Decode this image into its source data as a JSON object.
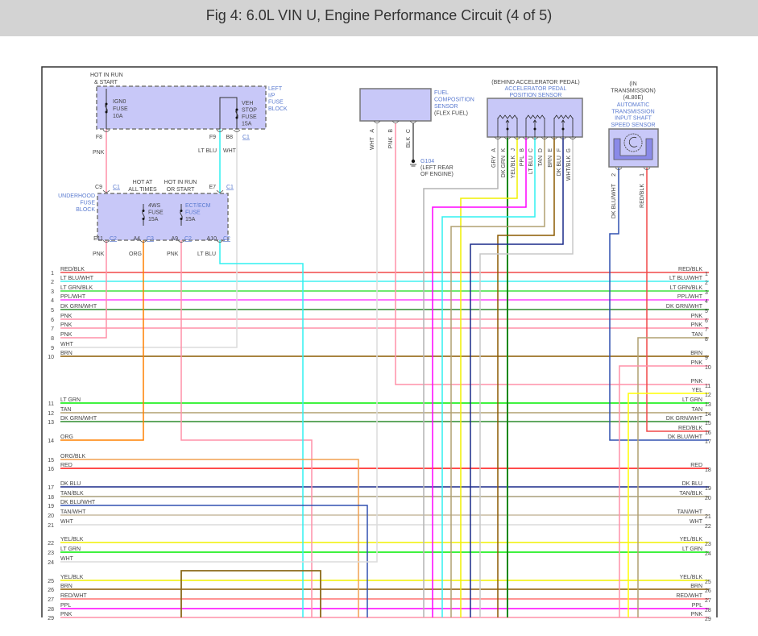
{
  "title": "Fig 4: 6.0L VIN U, Engine Performance Circuit (4 of 5)",
  "left_ip_fuse_block": {
    "name": [
      "LEFT",
      "I/P",
      "FUSE",
      "BLOCK"
    ],
    "supply": [
      "HOT IN RUN",
      "& START"
    ],
    "fuse_ign0": [
      "IGN0",
      "FUSE",
      "10A"
    ],
    "fuse_veh_stop": [
      "VEH",
      "STOP",
      "FUSE",
      "15A"
    ],
    "pins": [
      {
        "pin": "F8",
        "wire": "PNK"
      },
      {
        "pin": "F9",
        "wire": "LT BLU"
      },
      {
        "pin": "B8",
        "wire": "WHT"
      }
    ],
    "connector": "C1"
  },
  "underhood_fuse_block": {
    "name": [
      "UNDERHOOD",
      "FUSE",
      "BLOCK"
    ],
    "supply_4ws": [
      "HOT AT",
      "ALL TIMES"
    ],
    "supply_ect": [
      "HOT IN RUN",
      "OR START"
    ],
    "fuse_4ws": [
      "4WS",
      "FUSE",
      "15A"
    ],
    "fuse_ect": [
      "ECT/ECM",
      "FUSE",
      "15A"
    ],
    "top_pins": [
      {
        "pin": "C9",
        "conn": "C1"
      },
      {
        "pin": "E7",
        "conn": "C1"
      }
    ],
    "bottom_pins": [
      {
        "pin": "E11",
        "conn": "C2",
        "wire": "PNK"
      },
      {
        "pin": "A4",
        "conn": "C3",
        "wire": "ORG"
      },
      {
        "pin": "A9",
        "conn": "C2",
        "wire": "PNK"
      },
      {
        "pin": "A10",
        "conn": "C2",
        "wire": "LT BLU"
      }
    ]
  },
  "fuel_sensor": {
    "name": [
      "FUEL",
      "COMPOSITION",
      "SENSOR",
      "(FLEX FUEL)"
    ],
    "pins": [
      {
        "pin": "A",
        "wire": "WHT"
      },
      {
        "pin": "B",
        "wire": "PNK"
      },
      {
        "pin": "C",
        "wire": "BLK"
      }
    ],
    "ground": {
      "id": "G104",
      "location": [
        "(LEFT REAR",
        "OF ENGINE)"
      ]
    }
  },
  "app_sensor": {
    "location": "(BEHIND ACCELERATOR PEDAL)",
    "name": [
      "ACCELERATOR PEDAL",
      "POSITION SENSOR"
    ],
    "pins": [
      {
        "pin": "A",
        "wire": "GRY"
      },
      {
        "pin": "K",
        "wire": "DK GRN"
      },
      {
        "pin": "J",
        "wire": "YEL/BLK"
      },
      {
        "pin": "B",
        "wire": "PPL"
      },
      {
        "pin": "C",
        "wire": "LT BLU"
      },
      {
        "pin": "D",
        "wire": "TAN"
      },
      {
        "pin": "E",
        "wire": "BRN"
      },
      {
        "pin": "F",
        "wire": "DK BLU"
      },
      {
        "pin": "G",
        "wire": "WHT/BLK"
      }
    ]
  },
  "trans_sensor": {
    "location": [
      "(IN",
      "TRANSMISSION)",
      "(4L80E)"
    ],
    "name": [
      "AUTOMATIC",
      "TRANSMISSION",
      "INPUT SHAFT",
      "SPEED SENSOR"
    ],
    "pins": [
      {
        "pin": "2",
        "wire": "DK BLU/WHT"
      },
      {
        "pin": "1",
        "wire": "RED/BLK"
      }
    ]
  },
  "left_rows": [
    {
      "n": "1",
      "label": "RED/BLK"
    },
    {
      "n": "2",
      "label": "LT BLU/WHT"
    },
    {
      "n": "3",
      "label": "LT GRN/BLK"
    },
    {
      "n": "4",
      "label": "PPL/WHT"
    },
    {
      "n": "5",
      "label": "DK GRN/WHT"
    },
    {
      "n": "6",
      "label": "PNK"
    },
    {
      "n": "7",
      "label": "PNK"
    },
    {
      "n": "8",
      "label": "PNK"
    },
    {
      "n": "9",
      "label": "WHT"
    },
    {
      "n": "10",
      "label": "BRN"
    },
    {
      "n": "11",
      "label": "LT GRN"
    },
    {
      "n": "12",
      "label": "TAN"
    },
    {
      "n": "13",
      "label": "DK GRN/WHT"
    },
    {
      "n": "14",
      "label": "ORG"
    },
    {
      "n": "15",
      "label": "ORG/BLK"
    },
    {
      "n": "16",
      "label": "RED"
    },
    {
      "n": "17",
      "label": "DK BLU"
    },
    {
      "n": "18",
      "label": "TAN/BLK"
    },
    {
      "n": "19",
      "label": "DK BLU/WHT"
    },
    {
      "n": "20",
      "label": "TAN/WHT"
    },
    {
      "n": "21",
      "label": "WHT"
    },
    {
      "n": "22",
      "label": "YEL/BLK"
    },
    {
      "n": "23",
      "label": "LT GRN"
    },
    {
      "n": "24",
      "label": "WHT"
    },
    {
      "n": "25",
      "label": "YEL/BLK"
    },
    {
      "n": "26",
      "label": "BRN"
    },
    {
      "n": "27",
      "label": "RED/WHT"
    },
    {
      "n": "28",
      "label": "PPL"
    },
    {
      "n": "29",
      "label": "PNK"
    }
  ],
  "right_rows": [
    {
      "n": "1",
      "label": "RED/BLK"
    },
    {
      "n": "2",
      "label": "LT BLU/WHT"
    },
    {
      "n": "3",
      "label": "LT GRN/BLK"
    },
    {
      "n": "4",
      "label": "PPL/WHT"
    },
    {
      "n": "5",
      "label": "DK GRN/WHT"
    },
    {
      "n": "6",
      "label": "PNK"
    },
    {
      "n": "7",
      "label": "PNK"
    },
    {
      "n": "8",
      "label": "TAN"
    },
    {
      "n": "9",
      "label": "BRN"
    },
    {
      "n": "10",
      "label": "PNK"
    },
    {
      "n": "11",
      "label": "PNK"
    },
    {
      "n": "12",
      "label": "YEL"
    },
    {
      "n": "13",
      "label": "LT GRN"
    },
    {
      "n": "14",
      "label": "TAN"
    },
    {
      "n": "15",
      "label": "DK GRN/WHT"
    },
    {
      "n": "16",
      "label": "RED/BLK"
    },
    {
      "n": "17",
      "label": "DK BLU/WHT"
    },
    {
      "n": "18",
      "label": "RED"
    },
    {
      "n": "19",
      "label": "DK BLU"
    },
    {
      "n": "20",
      "label": "TAN/BLK"
    },
    {
      "n": "21",
      "label": "TAN/WHT"
    },
    {
      "n": "22",
      "label": "WHT"
    },
    {
      "n": "23",
      "label": "YEL/BLK"
    },
    {
      "n": "24",
      "label": "LT GRN"
    },
    {
      "n": "25",
      "label": "YEL/BLK"
    },
    {
      "n": "26",
      "label": "BRN"
    },
    {
      "n": "27",
      "label": "RED/WHT"
    },
    {
      "n": "28",
      "label": "PPL"
    },
    {
      "n": "29",
      "label": "PNK"
    }
  ],
  "wire_colors": {
    "RED/BLK": "#f04848",
    "LT BLU/WHT": "#40f0f0",
    "LT GRN/BLK": "#40e040",
    "PPL/WHT": "#ff40ff",
    "DK GRN/WHT": "#2e8b2e",
    "PNK": "#ff90a8",
    "WHT": "#dcdcdc",
    "BRN": "#8b5a00",
    "LT GRN": "#00ee00",
    "TAN": "#b0a070",
    "ORG": "#ff8000",
    "ORG/BLK": "#f0a050",
    "RED": "#ff1010",
    "DK BLU": "#1a2a8a",
    "TAN/BLK": "#a89e78",
    "DK BLU/WHT": "#3050b0",
    "TAN/WHT": "#c8bca0",
    "YEL/BLK": "#f0f000",
    "YEL": "#ffff00",
    "RED/WHT": "#ff7070",
    "PPL": "#ff00ff",
    "GRY": "#b4b4b4",
    "DK GRN": "#118811",
    "LT BLU": "#30f0f0",
    "WHT/BLK": "#c8c8c8",
    "BLK": "#555555",
    "BOX": "#8b6a1a"
  },
  "component_fill": "#c8c8f8"
}
